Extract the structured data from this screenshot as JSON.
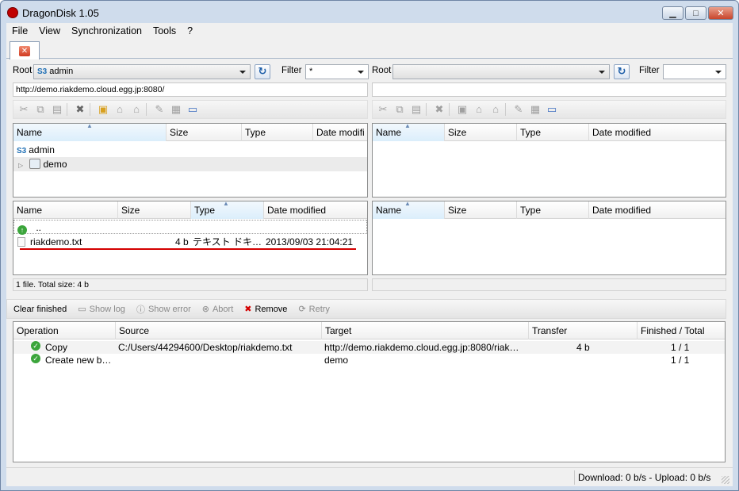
{
  "window": {
    "title": "DragonDisk 1.05"
  },
  "menu": [
    "File",
    "View",
    "Synchronization",
    "Tools",
    "?"
  ],
  "left": {
    "root_label": "Root",
    "root_value": "admin",
    "filter_label": "Filter",
    "filter_value": "*",
    "url": "http://demo.riakdemo.cloud.egg.jp:8080/",
    "tree_headers": [
      "Name",
      "Size",
      "Type",
      "Date modifi"
    ],
    "tree": [
      {
        "name": "admin"
      },
      {
        "name": "demo"
      }
    ],
    "file_headers": [
      "Name",
      "Size",
      "Type",
      "Date modified"
    ],
    "up_label": "..",
    "files": [
      {
        "name": "riakdemo.txt",
        "size": "4 b",
        "type": "テキスト ドキ…",
        "date": "2013/09/03 21:04:21"
      }
    ],
    "status": "1 file. Total size: 4 b",
    "s3_badge": "S3"
  },
  "right": {
    "root_label": "Root",
    "root_value": "",
    "filter_label": "Filter",
    "filter_value": "",
    "url": "",
    "tree_headers": [
      "Name",
      "Size",
      "Type",
      "Date modified"
    ],
    "file_headers": [
      "Name",
      "Size",
      "Type",
      "Date modified"
    ]
  },
  "actions": {
    "clear": "Clear finished",
    "show_log": "Show log",
    "show_error": "Show error",
    "abort": "Abort",
    "remove": "Remove",
    "retry": "Retry"
  },
  "operations": {
    "headers": [
      "Operation",
      "Source",
      "Target",
      "Transfer",
      "Finished / Total"
    ],
    "rows": [
      {
        "op": "Copy",
        "source": "C:/Users/44294600/Desktop/riakdemo.txt",
        "target": "http://demo.riakdemo.cloud.egg.jp:8080/riak…",
        "transfer": "4 b",
        "finished": "1 / 1"
      },
      {
        "op": "Create new b…",
        "source": "",
        "target": "demo",
        "transfer": "",
        "finished": "1 / 1"
      }
    ]
  },
  "statusbar": {
    "speed": "Download: 0 b/s - Upload: 0 b/s"
  },
  "colors": {
    "accent": "#1f6fb5",
    "underline": "#d40000",
    "ok": "#3ba53b"
  }
}
